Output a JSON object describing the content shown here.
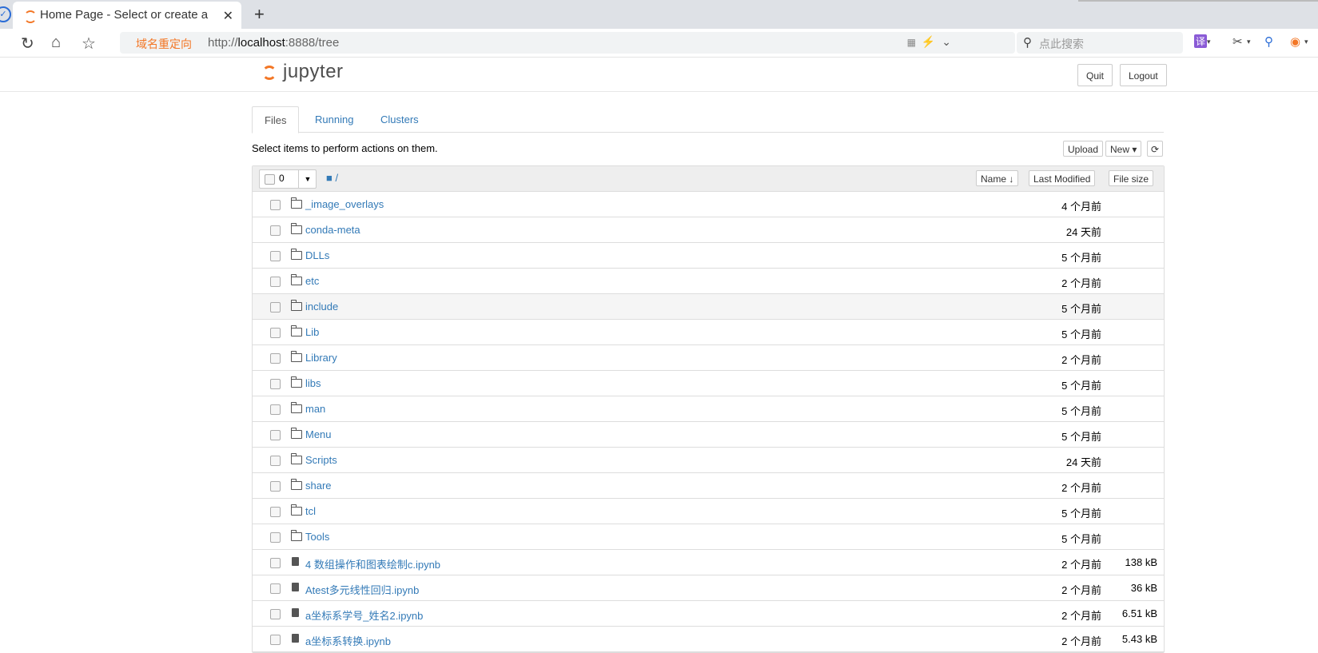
{
  "browser": {
    "tab_title": "Home Page - Select or create a",
    "new_tab": "+",
    "redirect_label": "域名重定向",
    "url_prefix": "http://",
    "url_host": "localhost",
    "url_rest": ":8888/tree",
    "search_placeholder": "点此搜索",
    "translate_icon": "译"
  },
  "header": {
    "logo_text": "jupyter",
    "quit_label": "Quit",
    "logout_label": "Logout"
  },
  "tabs": [
    {
      "label": "Files"
    },
    {
      "label": "Running"
    },
    {
      "label": "Clusters"
    }
  ],
  "toolbar": {
    "hint": "Select items to perform actions on them.",
    "upload_label": "Upload",
    "new_label": "New ▾",
    "refresh_icon": "⟳"
  },
  "list_header": {
    "selected_count": "0",
    "breadcrumb": "/",
    "name_label": "Name ↓",
    "last_modified_label": "Last Modified",
    "file_size_label": "File size"
  },
  "rows": [
    {
      "name": "_image_overlays",
      "type": "folder",
      "modified": "4 个月前",
      "size": ""
    },
    {
      "name": "conda-meta",
      "type": "folder",
      "modified": "24 天前",
      "size": ""
    },
    {
      "name": "DLLs",
      "type": "folder",
      "modified": "5 个月前",
      "size": ""
    },
    {
      "name": "etc",
      "type": "folder",
      "modified": "2 个月前",
      "size": ""
    },
    {
      "name": "include",
      "type": "folder",
      "modified": "5 个月前",
      "size": ""
    },
    {
      "name": "Lib",
      "type": "folder",
      "modified": "5 个月前",
      "size": ""
    },
    {
      "name": "Library",
      "type": "folder",
      "modified": "2 个月前",
      "size": ""
    },
    {
      "name": "libs",
      "type": "folder",
      "modified": "5 个月前",
      "size": ""
    },
    {
      "name": "man",
      "type": "folder",
      "modified": "5 个月前",
      "size": ""
    },
    {
      "name": "Menu",
      "type": "folder",
      "modified": "5 个月前",
      "size": ""
    },
    {
      "name": "Scripts",
      "type": "folder",
      "modified": "24 天前",
      "size": ""
    },
    {
      "name": "share",
      "type": "folder",
      "modified": "2 个月前",
      "size": ""
    },
    {
      "name": "tcl",
      "type": "folder",
      "modified": "5 个月前",
      "size": ""
    },
    {
      "name": "Tools",
      "type": "folder",
      "modified": "5 个月前",
      "size": ""
    },
    {
      "name": "4 数组操作和图表绘制c.ipynb",
      "type": "notebook",
      "modified": "2 个月前",
      "size": "138 kB"
    },
    {
      "name": "Atest多元线性回归.ipynb",
      "type": "notebook",
      "modified": "2 个月前",
      "size": "36 kB"
    },
    {
      "name": "a坐标系学号_姓名2.ipynb",
      "type": "notebook",
      "modified": "2 个月前",
      "size": "6.51 kB"
    },
    {
      "name": "a坐标系转换.ipynb",
      "type": "notebook",
      "modified": "2 个月前",
      "size": "5.43 kB"
    }
  ]
}
